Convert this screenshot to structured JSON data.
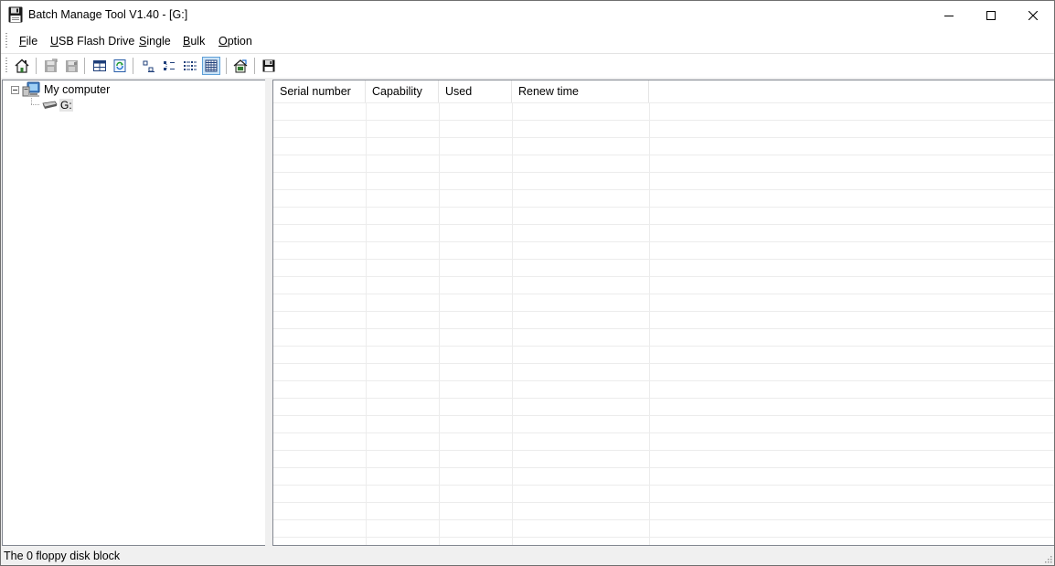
{
  "window": {
    "title": "Batch Manage Tool V1.40  - [G:]"
  },
  "menu": {
    "items": [
      "File",
      "USB Flash Drive",
      "Single",
      "Bulk",
      "Option"
    ]
  },
  "toolbar": {
    "buttons": [
      {
        "icon": "home-icon",
        "enabled": true
      },
      {
        "icon": "save-gray-icon",
        "enabled": false
      },
      {
        "icon": "save-gray-alt-icon",
        "enabled": false
      },
      {
        "icon": "grid-icon",
        "enabled": true
      },
      {
        "icon": "refresh-icon",
        "enabled": true
      },
      {
        "icon": "large-icons-view-icon",
        "enabled": true
      },
      {
        "icon": "small-icons-view-icon",
        "enabled": true
      },
      {
        "icon": "list-view-icon",
        "enabled": true
      },
      {
        "icon": "details-view-icon",
        "enabled": true,
        "active": true
      },
      {
        "icon": "properties-icon",
        "enabled": true
      },
      {
        "icon": "floppy-save-icon",
        "enabled": true
      }
    ]
  },
  "tree": {
    "root_label": "My computer",
    "children": [
      {
        "label": "G:",
        "icon": "drive-icon",
        "selected": true
      }
    ]
  },
  "list": {
    "columns": [
      "Serial number",
      "Capability",
      "Used",
      "Renew time"
    ],
    "rows": []
  },
  "status": {
    "text": "The 0 floppy disk block"
  },
  "colors": {
    "accent": "#5ea0d8",
    "active_bg": "#cce4f7",
    "pane_border": "#828790"
  }
}
